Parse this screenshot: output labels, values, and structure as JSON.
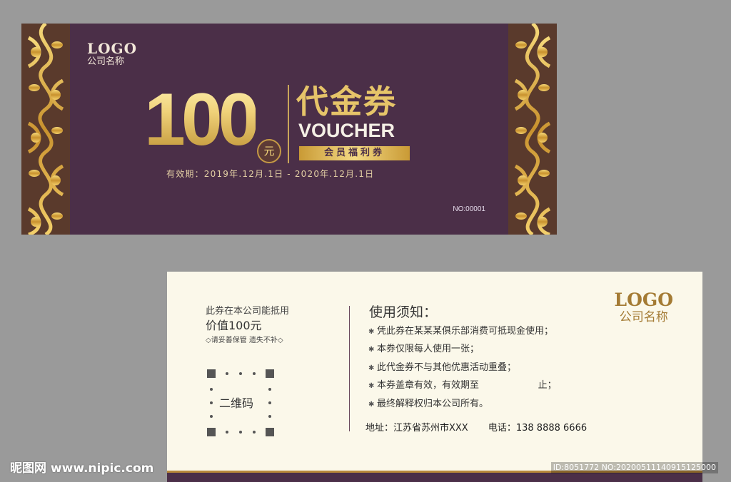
{
  "front": {
    "logo": "LOGO",
    "company": "公司名称",
    "amount": "100",
    "yuan": "元",
    "title_cn": "代金券",
    "title_en": "VOUCHER",
    "member": "会员福利券",
    "validity": "有效期：2019年.12月.1日 - 2020年.12月.1日",
    "serial": "NO:00001",
    "colors": {
      "background": "#4b2f48",
      "gold": "#d9b65a"
    }
  },
  "back": {
    "line1": "此券在本公司能抵用",
    "line2": "价值100元",
    "line3": "◇请妥善保管 遗失不补◇",
    "qr_label": "二维码",
    "notice_title": "使用须知：",
    "notices": [
      "凭此券在某某某俱乐部消费可抵现金使用；",
      "本券仅限每人使用一张；",
      "此代金券不与其他优惠活动重叠；",
      "本券盖章有效，有效期至                    止；",
      "最终解释权归本公司所有。"
    ],
    "address": "地址：江苏省苏州市XXX",
    "phone": "电话：138 8888 6666",
    "logo": "LOGO",
    "company": "公司名称",
    "colors": {
      "background": "#fbf8ea",
      "logo": "#a47b34"
    }
  },
  "watermark": {
    "left": "昵图网 www.nipic.com",
    "right": "ID:8051772 NO:20200511140915125000"
  }
}
